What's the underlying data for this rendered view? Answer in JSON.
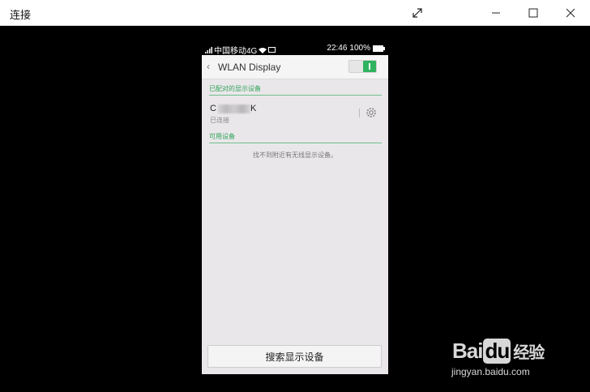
{
  "window": {
    "title": "连接",
    "expand_icon": "expand-icon",
    "min_icon": "minimize-icon",
    "max_icon": "maximize-icon",
    "close_icon": "close-icon"
  },
  "phone": {
    "status": {
      "carrier": "中国移动4G",
      "time": "22:46",
      "battery": "100%"
    },
    "appbar": {
      "back": "‹",
      "title": "WLAN Display",
      "toggle_on": true
    },
    "paired_section": "已配对的显示设备",
    "device": {
      "name_prefix": "C",
      "name_suffix": "K",
      "status": "已连接"
    },
    "available_section": "可用设备",
    "empty_message": "找不到附近有无线显示设备。",
    "search_button": "搜索显示设备"
  },
  "watermark": {
    "brand_a": "Bai",
    "brand_b": "du",
    "brand_c": "经验",
    "url": "jingyan.baidu.com"
  },
  "colors": {
    "accent_green": "#2fb35f",
    "section_green": "#2fa35a",
    "phone_bg": "#eae7ea"
  }
}
